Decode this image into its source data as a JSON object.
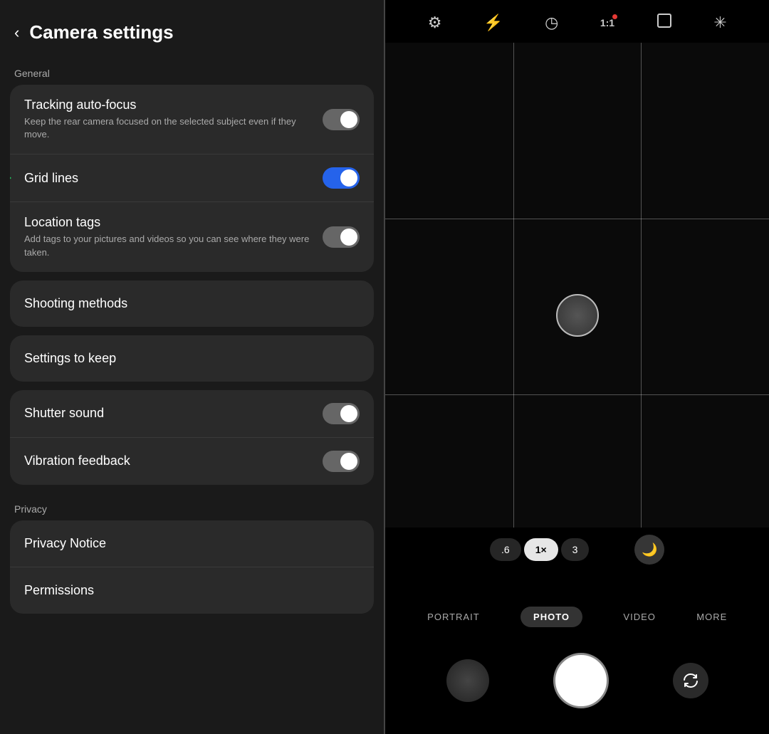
{
  "header": {
    "back_label": "‹",
    "title": "Camera settings"
  },
  "sections": {
    "general_label": "General",
    "privacy_label": "Privacy"
  },
  "general_card": {
    "items": [
      {
        "id": "tracking-autofocus",
        "title": "Tracking auto-focus",
        "desc": "Keep the rear camera focused on the selected subject even if they move.",
        "toggle": "on-gray"
      },
      {
        "id": "grid-lines",
        "title": "Grid lines",
        "desc": "",
        "toggle": "on-blue"
      },
      {
        "id": "location-tags",
        "title": "Location tags",
        "desc": "Add tags to your pictures and videos so you can see where they were taken.",
        "toggle": "on-gray"
      }
    ]
  },
  "nav_items": [
    {
      "id": "shooting-methods",
      "title": "Shooting methods"
    },
    {
      "id": "settings-to-keep",
      "title": "Settings to keep"
    }
  ],
  "mixed_card": {
    "items": [
      {
        "id": "shutter-sound",
        "title": "Shutter sound",
        "toggle": "off"
      },
      {
        "id": "vibration-feedback",
        "title": "Vibration feedback",
        "toggle": "off"
      }
    ]
  },
  "privacy_card": {
    "items": [
      {
        "id": "privacy-notice",
        "title": "Privacy Notice"
      },
      {
        "id": "permissions",
        "title": "Permissions"
      }
    ]
  },
  "camera": {
    "zoom_levels": [
      ".6",
      "1×",
      "3"
    ],
    "active_zoom": "1×",
    "modes": [
      "PORTRAIT",
      "PHOTO",
      "VIDEO",
      "MORE"
    ],
    "active_mode": "PHOTO",
    "icons": {
      "settings": "⚙",
      "flash": "⚡",
      "timer": "◷",
      "ratio": "1:1",
      "crop": "▣",
      "effect": "✳"
    }
  }
}
